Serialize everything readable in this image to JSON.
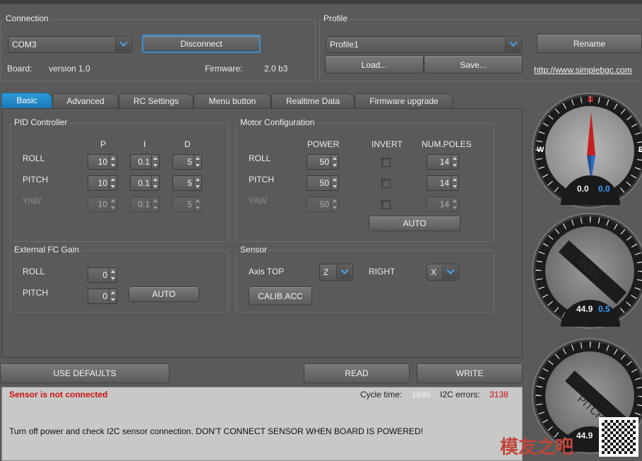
{
  "connection": {
    "title": "Connection",
    "port": "COM3",
    "disconnect_label": "Disconnect",
    "board_label": "Board:",
    "board_value": "version 1.0",
    "firmware_label": "Firmware:",
    "firmware_value": "2.0 b3"
  },
  "profile": {
    "title": "Profile",
    "selected": "Profile1",
    "load_label": "Load...",
    "save_label": "Save...",
    "rename_label": "Rename",
    "link": "http://www.simplebgc.com"
  },
  "tabs": [
    {
      "label": "Basic",
      "active": true
    },
    {
      "label": "Advanced"
    },
    {
      "label": "RC Settings"
    },
    {
      "label": "Menu button"
    },
    {
      "label": "Realtime Data"
    },
    {
      "label": "Firmware upgrade"
    }
  ],
  "pid": {
    "title": "PID Controller",
    "headers": [
      "P",
      "I",
      "D"
    ],
    "rows": [
      {
        "label": "ROLL",
        "p": "10",
        "i": "0.1",
        "d": "5"
      },
      {
        "label": "PITCH",
        "p": "10",
        "i": "0.1",
        "d": "5"
      },
      {
        "label": "YAW",
        "p": "10",
        "i": "0.1",
        "d": "5"
      }
    ]
  },
  "motor": {
    "title": "Motor Configuration",
    "headers": [
      "POWER",
      "INVERT",
      "NUM.POLES"
    ],
    "rows": [
      {
        "label": "ROLL",
        "power": "50",
        "poles": "14"
      },
      {
        "label": "PITCH",
        "power": "50",
        "poles": "14"
      },
      {
        "label": "YAW",
        "power": "50",
        "poles": "14"
      }
    ],
    "auto_label": "AUTO"
  },
  "fc_gain": {
    "title": "External FC Gain",
    "rows": [
      {
        "label": "ROLL",
        "value": "0"
      },
      {
        "label": "PITCH",
        "value": "0"
      }
    ],
    "auto_label": "AUTO"
  },
  "sensor": {
    "title": "Sensor",
    "axis_top_label": "Axis TOP",
    "axis_top_value": "Z",
    "right_label": "RIGHT",
    "right_value": "X",
    "calib_label": "CALIB.ACC"
  },
  "actions": {
    "defaults_label": "USE DEFAULTS",
    "read_label": "READ",
    "write_label": "WRITE"
  },
  "status": {
    "error": "Sensor is not connected",
    "cycle_label": "Cycle time:",
    "cycle_value": "1846",
    "i2c_label": "I2C errors:",
    "i2c_value": "3138",
    "message": "Turn off power and check I2C sensor connection. DON'T CONNECT SENSOR WHEN BOARD IS POWERED!"
  },
  "gauges": {
    "compass": {
      "n": "N",
      "w": "W",
      "e": "E",
      "value_a": "0.0",
      "value_b": "0.0"
    },
    "roll": {
      "label": "ROLL",
      "value_a": "44.9",
      "value_b": "0.5"
    },
    "pitch": {
      "label": "PITCH",
      "value_a": "44.9"
    }
  },
  "watermark": {
    "text": "模友之吧"
  },
  "colors": {
    "accent": "#2a9ad6",
    "error": "#cc1010",
    "status_bg": "#c8c8c8"
  }
}
